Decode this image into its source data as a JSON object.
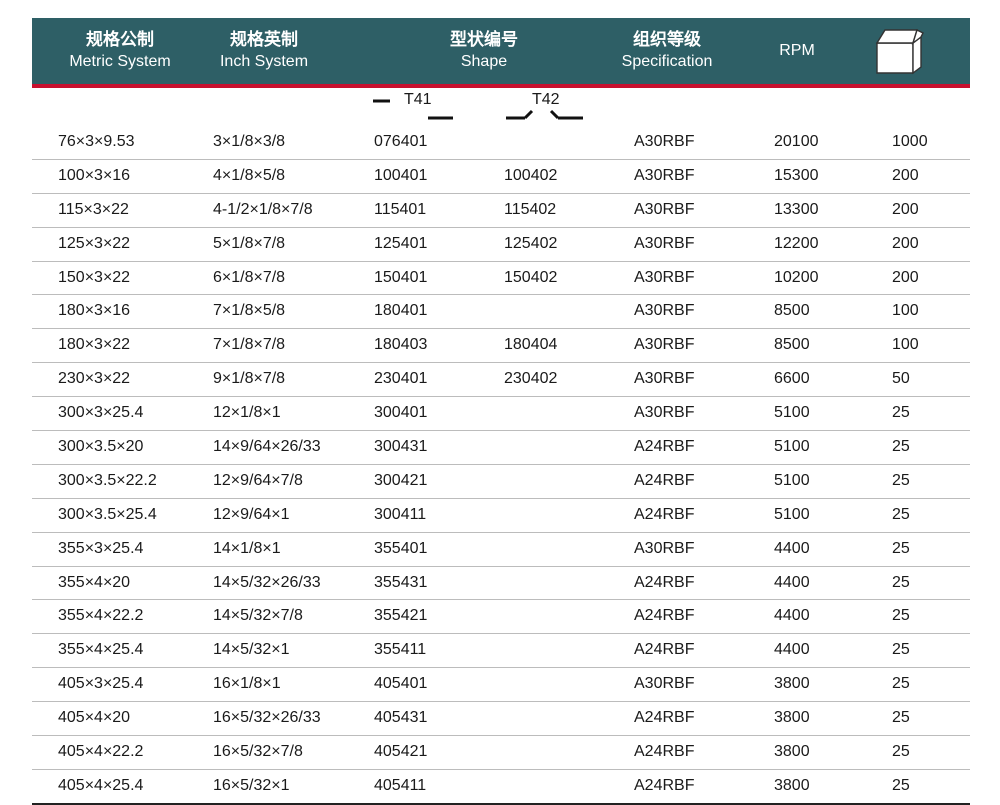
{
  "header": {
    "columns": [
      {
        "zh": "规格公制",
        "en": "Metric System"
      },
      {
        "zh": "规格英制",
        "en": "Inch System"
      },
      {
        "zh": "型状编号",
        "en": "Shape"
      },
      {
        "zh": "组织等级",
        "en": "Specification"
      },
      {
        "zh": "",
        "en": "RPM"
      }
    ],
    "box_icon": "box-icon"
  },
  "shapes": {
    "t41": "T41",
    "t42": "T42"
  },
  "rows": [
    [
      "76×3×9.53",
      "3×1/8×3/8",
      "076401",
      "",
      "A30RBF",
      "20100",
      "1000"
    ],
    [
      "100×3×16",
      "4×1/8×5/8",
      "100401",
      "100402",
      "A30RBF",
      "15300",
      "200"
    ],
    [
      "115×3×22",
      "4-1/2×1/8×7/8",
      "115401",
      "115402",
      "A30RBF",
      "13300",
      "200"
    ],
    [
      "125×3×22",
      "5×1/8×7/8",
      "125401",
      "125402",
      "A30RBF",
      "12200",
      "200"
    ],
    [
      "150×3×22",
      "6×1/8×7/8",
      "150401",
      "150402",
      "A30RBF",
      "10200",
      "200"
    ],
    [
      "180×3×16",
      "7×1/8×5/8",
      "180401",
      "",
      "A30RBF",
      "8500",
      "100"
    ],
    [
      "180×3×22",
      "7×1/8×7/8",
      "180403",
      "180404",
      "A30RBF",
      "8500",
      "100"
    ],
    [
      "230×3×22",
      "9×1/8×7/8",
      "230401",
      "230402",
      "A30RBF",
      "6600",
      "50"
    ],
    [
      "300×3×25.4",
      "12×1/8×1",
      "300401",
      "",
      "A30RBF",
      "5100",
      "25"
    ],
    [
      "300×3.5×20",
      "14×9/64×26/33",
      "300431",
      "",
      "A24RBF",
      "5100",
      "25"
    ],
    [
      "300×3.5×22.2",
      "12×9/64×7/8",
      "300421",
      "",
      "A24RBF",
      "5100",
      "25"
    ],
    [
      "300×3.5×25.4",
      "12×9/64×1",
      "300411",
      "",
      "A24RBF",
      "5100",
      "25"
    ],
    [
      "355×3×25.4",
      "14×1/8×1",
      "355401",
      "",
      "A30RBF",
      "4400",
      "25"
    ],
    [
      "355×4×20",
      "14×5/32×26/33",
      "355431",
      "",
      "A24RBF",
      "4400",
      "25"
    ],
    [
      "355×4×22.2",
      "14×5/32×7/8",
      "355421",
      "",
      "A24RBF",
      "4400",
      "25"
    ],
    [
      "355×4×25.4",
      "14×5/32×1",
      "355411",
      "",
      "A24RBF",
      "4400",
      "25"
    ],
    [
      "405×3×25.4",
      "16×1/8×1",
      "405401",
      "",
      "A30RBF",
      "3800",
      "25"
    ],
    [
      "405×4×20",
      "16×5/32×26/33",
      "405431",
      "",
      "A24RBF",
      "3800",
      "25"
    ],
    [
      "405×4×22.2",
      "16×5/32×7/8",
      "405421",
      "",
      "A24RBF",
      "3800",
      "25"
    ],
    [
      "405×4×25.4",
      "16×5/32×1",
      "405411",
      "",
      "A24RBF",
      "3800",
      "25"
    ]
  ]
}
